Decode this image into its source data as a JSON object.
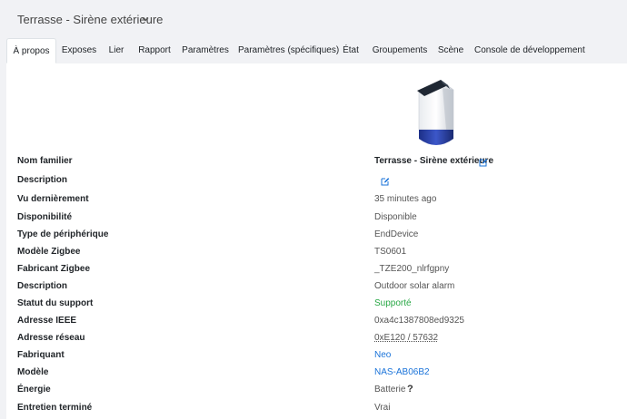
{
  "header": {
    "title": "Terrasse - Sirène extérieure"
  },
  "tabs": [
    "À propos",
    "Exposes",
    "Lier",
    "Rapport",
    "Paramètres",
    "Paramètres (spécifiques)",
    "État",
    "Groupements",
    "Scène",
    "Console de développement"
  ],
  "active_tab": "À propos",
  "rows": {
    "friendly_name": {
      "label": "Nom familier",
      "value": "Terrasse - Sirène extérieure"
    },
    "description_user": {
      "label": "Description",
      "value": ""
    },
    "last_seen": {
      "label": "Vu dernièrement",
      "value": "35 minutes ago"
    },
    "availability": {
      "label": "Disponibilité",
      "value": "Disponible"
    },
    "device_type": {
      "label": "Type de périphérique",
      "value": "EndDevice"
    },
    "zigbee_model": {
      "label": "Modèle Zigbee",
      "value": "TS0601"
    },
    "zigbee_manufacturer": {
      "label": "Fabricant Zigbee",
      "value": "_TZE200_nlrfgpny"
    },
    "description": {
      "label": "Description",
      "value": "Outdoor solar alarm"
    },
    "support_status": {
      "label": "Statut du support",
      "value": "Supporté"
    },
    "ieee_address": {
      "label": "Adresse IEEE",
      "value": "0xa4c1387808ed9325"
    },
    "network_address": {
      "label": "Adresse réseau",
      "value": "0xE120 / 57632"
    },
    "manufacturer": {
      "label": "Fabriquant",
      "value": "Neo"
    },
    "model": {
      "label": "Modèle",
      "value": "NAS-AB06B2"
    },
    "power": {
      "label": "Énergie",
      "value": "Batterie",
      "help": "?"
    },
    "interview_completed": {
      "label": "Entretien terminé",
      "value": "Vrai"
    }
  },
  "colors": {
    "background": "#f1f2f5",
    "panel": "#ffffff",
    "link": "#1a73d9",
    "supported": "#28a745",
    "edit_icon": "#1a73d9"
  },
  "icons": {
    "title_chevron": "chevron-down-icon",
    "edit": "edit-icon",
    "help": "help-icon"
  }
}
